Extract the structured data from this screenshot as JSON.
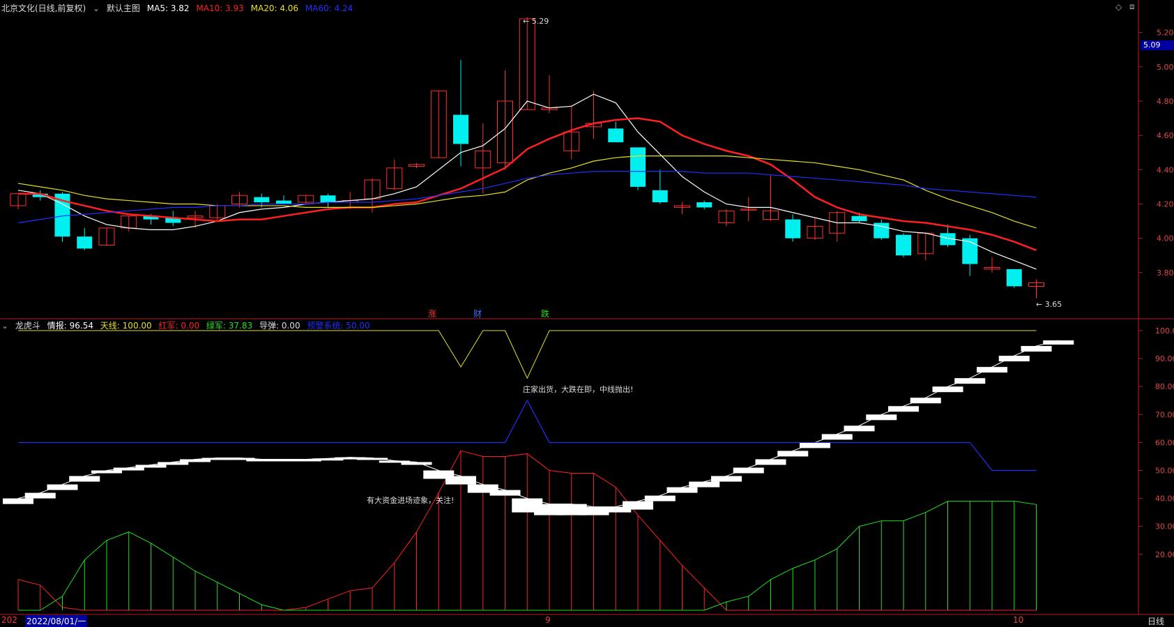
{
  "header": {
    "stock_title": "北京文化(日线,前复权)",
    "main_chart_label": "默认主图",
    "ma": [
      {
        "label": "MA5:",
        "value": "3.82",
        "color": "#ffffff"
      },
      {
        "label": "MA10:",
        "value": "3.93",
        "color": "#ff2020"
      },
      {
        "label": "MA20:",
        "value": "4.06",
        "color": "#e8e020"
      },
      {
        "label": "MA60:",
        "value": "4.24",
        "color": "#2030ff"
      }
    ]
  },
  "indicator_header": {
    "name": "龙虎斗",
    "items": [
      {
        "label": "情报:",
        "value": "96.54",
        "color": "#ffffff"
      },
      {
        "label": "天线:",
        "value": "100.00",
        "color": "#e8e020"
      },
      {
        "label": "红军:",
        "value": "0.00",
        "color": "#ff2020"
      },
      {
        "label": "绿军:",
        "value": "37.83",
        "color": "#20e020"
      },
      {
        "label": "导弹:",
        "value": "0.00",
        "color": "#dddddd"
      },
      {
        "label": "预警系统:",
        "value": "50.00",
        "color": "#2030ff"
      }
    ]
  },
  "signals": [
    {
      "text": "涨",
      "color": "#ff3030"
    },
    {
      "text": "财",
      "color": "#4070ff"
    },
    {
      "text": "跌",
      "color": "#20e020"
    }
  ],
  "annotations": {
    "high_label": "5.29",
    "low_label": "3.65",
    "current_price": "5.09",
    "note_sell": "庄家出货，大跌在即，中线抛出!",
    "note_buy": "有大资金进场迹象，关注!"
  },
  "bottom_bar": {
    "date_left": "202",
    "date_cursor": "2022/08/01/一",
    "month_9": "9",
    "month_10": "10",
    "period": "日线"
  },
  "chart_data": [
    {
      "type": "candlestick",
      "ylim": [
        3.6,
        5.3
      ],
      "y_ticks": [
        "5.20",
        "5.00",
        "4.80",
        "4.60",
        "4.40",
        "4.20",
        "4.00",
        "3.80"
      ],
      "candles": [
        {
          "o": 4.19,
          "h": 4.25,
          "l": 4.17,
          "c": 4.26
        },
        {
          "o": 4.26,
          "h": 4.28,
          "l": 4.22,
          "c": 4.24
        },
        {
          "o": 4.26,
          "h": 4.27,
          "l": 3.98,
          "c": 4.01
        },
        {
          "o": 4.01,
          "h": 4.06,
          "l": 3.93,
          "c": 3.94
        },
        {
          "o": 3.96,
          "h": 4.06,
          "l": 3.96,
          "c": 4.06
        },
        {
          "o": 4.06,
          "h": 4.13,
          "l": 4.04,
          "c": 4.13
        },
        {
          "o": 4.13,
          "h": 4.14,
          "l": 4.08,
          "c": 4.11
        },
        {
          "o": 4.12,
          "h": 4.16,
          "l": 4.07,
          "c": 4.09
        },
        {
          "o": 4.12,
          "h": 4.16,
          "l": 4.06,
          "c": 4.13
        },
        {
          "o": 4.12,
          "h": 4.2,
          "l": 4.1,
          "c": 4.19
        },
        {
          "o": 4.2,
          "h": 4.27,
          "l": 4.18,
          "c": 4.25
        },
        {
          "o": 4.24,
          "h": 4.26,
          "l": 4.18,
          "c": 4.21
        },
        {
          "o": 4.22,
          "h": 4.25,
          "l": 4.2,
          "c": 4.2
        },
        {
          "o": 4.21,
          "h": 4.25,
          "l": 4.2,
          "c": 4.25
        },
        {
          "o": 4.25,
          "h": 4.26,
          "l": 4.18,
          "c": 4.21
        },
        {
          "o": 4.21,
          "h": 4.27,
          "l": 4.17,
          "c": 4.22
        },
        {
          "o": 4.23,
          "h": 4.35,
          "l": 4.15,
          "c": 4.34
        },
        {
          "o": 4.29,
          "h": 4.46,
          "l": 4.28,
          "c": 4.41
        },
        {
          "o": 4.42,
          "h": 4.44,
          "l": 4.41,
          "c": 4.43
        },
        {
          "o": 4.47,
          "h": 4.86,
          "l": 4.47,
          "c": 4.86
        },
        {
          "o": 4.72,
          "h": 5.04,
          "l": 4.42,
          "c": 4.55
        },
        {
          "o": 4.41,
          "h": 4.67,
          "l": 4.26,
          "c": 4.51
        },
        {
          "o": 4.44,
          "h": 4.98,
          "l": 4.4,
          "c": 4.8
        },
        {
          "o": 4.75,
          "h": 5.29,
          "l": 4.75,
          "c": 5.28
        },
        {
          "o": 4.75,
          "h": 4.95,
          "l": 4.73,
          "c": 4.76
        },
        {
          "o": 4.51,
          "h": 4.77,
          "l": 4.46,
          "c": 4.62
        },
        {
          "o": 4.65,
          "h": 4.86,
          "l": 4.58,
          "c": 4.67
        },
        {
          "o": 4.64,
          "h": 4.68,
          "l": 4.56,
          "c": 4.56
        },
        {
          "o": 4.53,
          "h": 4.53,
          "l": 4.28,
          "c": 4.3
        },
        {
          "o": 4.28,
          "h": 4.4,
          "l": 4.2,
          "c": 4.21
        },
        {
          "o": 4.18,
          "h": 4.21,
          "l": 4.14,
          "c": 4.19
        },
        {
          "o": 4.21,
          "h": 4.22,
          "l": 4.17,
          "c": 4.18
        },
        {
          "o": 4.09,
          "h": 4.17,
          "l": 4.07,
          "c": 4.16
        },
        {
          "o": 4.17,
          "h": 4.24,
          "l": 4.1,
          "c": 4.17
        },
        {
          "o": 4.11,
          "h": 4.37,
          "l": 4.1,
          "c": 4.16
        },
        {
          "o": 4.11,
          "h": 4.14,
          "l": 3.98,
          "c": 4.0
        },
        {
          "o": 4.0,
          "h": 4.12,
          "l": 3.99,
          "c": 4.07
        },
        {
          "o": 4.03,
          "h": 4.16,
          "l": 3.98,
          "c": 4.15
        },
        {
          "o": 4.13,
          "h": 4.15,
          "l": 4.09,
          "c": 4.1
        },
        {
          "o": 4.09,
          "h": 4.11,
          "l": 3.99,
          "c": 4.0
        },
        {
          "o": 4.02,
          "h": 4.03,
          "l": 3.89,
          "c": 3.9
        },
        {
          "o": 3.91,
          "h": 4.03,
          "l": 3.87,
          "c": 4.03
        },
        {
          "o": 4.03,
          "h": 4.08,
          "l": 3.95,
          "c": 3.96
        },
        {
          "o": 4.0,
          "h": 4.02,
          "l": 3.78,
          "c": 3.85
        },
        {
          "o": 3.82,
          "h": 3.89,
          "l": 3.8,
          "c": 3.83
        },
        {
          "o": 3.82,
          "h": 3.82,
          "l": 3.71,
          "c": 3.72
        },
        {
          "o": 3.72,
          "h": 3.76,
          "l": 3.65,
          "c": 3.74
        }
      ],
      "series": [
        {
          "name": "MA5",
          "color": "#ffffff",
          "values": [
            4.28,
            4.26,
            4.2,
            4.13,
            4.08,
            4.06,
            4.05,
            4.05,
            4.07,
            4.1,
            4.15,
            4.17,
            4.18,
            4.2,
            4.21,
            4.22,
            4.23,
            4.26,
            4.3,
            4.4,
            4.5,
            4.54,
            4.64,
            4.8,
            4.76,
            4.77,
            4.84,
            4.79,
            4.62,
            4.49,
            4.36,
            4.27,
            4.2,
            4.18,
            4.18,
            4.15,
            4.12,
            4.09,
            4.09,
            4.07,
            4.04,
            4.03,
            4.0,
            3.98,
            3.92,
            3.87,
            3.82
          ]
        },
        {
          "name": "MA10",
          "color": "#ff2020",
          "values": [
            4.26,
            4.26,
            4.22,
            4.19,
            4.16,
            4.14,
            4.13,
            4.12,
            4.11,
            4.1,
            4.11,
            4.11,
            4.13,
            4.15,
            4.17,
            4.18,
            4.18,
            4.2,
            4.21,
            4.25,
            4.29,
            4.35,
            4.41,
            4.52,
            4.58,
            4.63,
            4.67,
            4.69,
            4.7,
            4.68,
            4.6,
            4.55,
            4.51,
            4.48,
            4.43,
            4.34,
            4.24,
            4.18,
            4.14,
            4.12,
            4.1,
            4.09,
            4.07,
            4.05,
            4.02,
            3.98,
            3.93
          ]
        },
        {
          "name": "MA20",
          "color": "#e8e020",
          "values": [
            4.32,
            4.3,
            4.28,
            4.25,
            4.23,
            4.22,
            4.21,
            4.2,
            4.2,
            4.19,
            4.19,
            4.19,
            4.19,
            4.18,
            4.18,
            4.18,
            4.18,
            4.19,
            4.2,
            4.22,
            4.24,
            4.25,
            4.27,
            4.34,
            4.38,
            4.41,
            4.45,
            4.47,
            4.48,
            4.48,
            4.48,
            4.48,
            4.48,
            4.47,
            4.46,
            4.45,
            4.44,
            4.42,
            4.4,
            4.37,
            4.34,
            4.28,
            4.23,
            4.19,
            4.15,
            4.1,
            4.06
          ]
        },
        {
          "name": "MA60",
          "color": "#2030ff",
          "values": [
            4.09,
            4.11,
            4.13,
            4.14,
            4.15,
            4.16,
            4.17,
            4.18,
            4.18,
            4.19,
            4.19,
            4.2,
            4.2,
            4.2,
            4.21,
            4.21,
            4.21,
            4.22,
            4.23,
            4.25,
            4.27,
            4.29,
            4.32,
            4.35,
            4.37,
            4.38,
            4.39,
            4.39,
            4.39,
            4.39,
            4.39,
            4.38,
            4.38,
            4.38,
            4.37,
            4.36,
            4.35,
            4.34,
            4.33,
            4.32,
            4.31,
            4.29,
            4.28,
            4.27,
            4.26,
            4.25,
            4.24
          ]
        }
      ]
    },
    {
      "type": "indicator",
      "ylim": [
        0,
        103
      ],
      "y_ticks": [
        "100.0",
        "90.00",
        "80.00",
        "70.00",
        "60.00",
        "50.00",
        "40.00",
        "30.00",
        "20.00"
      ],
      "tianxian": [
        100,
        100,
        100,
        100,
        100,
        100,
        100,
        100,
        100,
        100,
        100,
        100,
        100,
        100,
        100,
        100,
        100,
        100,
        100,
        100,
        87,
        100,
        100,
        83,
        100,
        100,
        100,
        100,
        100,
        100,
        100,
        100,
        100,
        100,
        100,
        100,
        100,
        100,
        100,
        100,
        100,
        100,
        100,
        100,
        100,
        100,
        100
      ],
      "yujing": [
        60,
        60,
        60,
        60,
        60,
        60,
        60,
        60,
        60,
        60,
        60,
        60,
        60,
        60,
        60,
        60,
        60,
        60,
        60,
        60,
        60,
        60,
        60,
        75,
        60,
        60,
        60,
        60,
        60,
        60,
        60,
        60,
        60,
        60,
        60,
        60,
        60,
        60,
        60,
        60,
        60,
        60,
        60,
        60,
        50,
        50,
        50
      ],
      "qingbao": [
        40,
        42,
        45,
        48,
        50,
        51,
        52,
        53,
        54,
        54.5,
        54.5,
        54,
        54,
        54,
        54.3,
        54.7,
        54.5,
        53.5,
        53,
        50,
        48,
        45,
        43,
        40,
        38,
        38,
        37,
        37,
        39,
        41,
        44,
        46,
        48,
        51,
        54,
        57,
        60,
        63,
        66,
        70,
        73,
        76,
        80,
        83,
        87,
        91,
        94.5,
        96.5
      ],
      "qingbao_prev": [
        38,
        40,
        43,
        46,
        49,
        50,
        51,
        52,
        53,
        54,
        54,
        53.5,
        53.5,
        53.5,
        53.8,
        54,
        54,
        53,
        52,
        47,
        45,
        42,
        41,
        35,
        34,
        34,
        34,
        35,
        36,
        39,
        42,
        44,
        46,
        49,
        52,
        55,
        58,
        61,
        64,
        68,
        71,
        74,
        78,
        81,
        85,
        89,
        92.5,
        95
      ],
      "hongjun": [
        11,
        9,
        1,
        0,
        0,
        0,
        0,
        0,
        0,
        0,
        0,
        0,
        0,
        1,
        4,
        7,
        8,
        17,
        28,
        42,
        57,
        55,
        55,
        56,
        50,
        49,
        49,
        44,
        34,
        25,
        16,
        8,
        0,
        0,
        0,
        0,
        0,
        0,
        0,
        0,
        0,
        0,
        0,
        0,
        0,
        0,
        0
      ],
      "lvjun": [
        0,
        0,
        5,
        18,
        25,
        28,
        24,
        19,
        14,
        10,
        6,
        2,
        0,
        0,
        0,
        0,
        0,
        0,
        0,
        0,
        0,
        0,
        0,
        0,
        0,
        0,
        0,
        0,
        0,
        0,
        0,
        0,
        3,
        5,
        11,
        15,
        18,
        22,
        30,
        32,
        32,
        35,
        39,
        39,
        39,
        39,
        37.83
      ]
    }
  ]
}
